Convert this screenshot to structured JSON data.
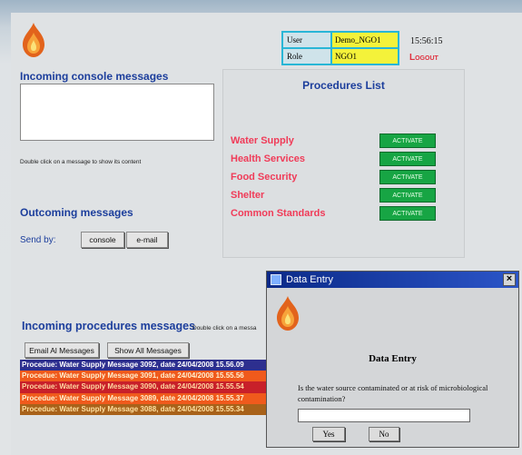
{
  "header": {
    "user_label": "User",
    "user_value": "Demo_NGO1",
    "role_label": "Role",
    "role_value": "NGO1",
    "time": "15:56:15",
    "logout": "Logout"
  },
  "incoming_console": {
    "title": "Incoming console messages",
    "hint": "Double click on a message to show its content"
  },
  "outgoing": {
    "title": "Outcoming messages",
    "send_by": "Send by:",
    "console_btn": "console",
    "email_btn": "e-mail"
  },
  "procedures": {
    "title": "Procedures List",
    "items": [
      {
        "label": "Water Supply",
        "button": "ACTIVATE"
      },
      {
        "label": "Health Services",
        "button": "ACTIVATE"
      },
      {
        "label": "Food Security",
        "button": "ACTIVATE"
      },
      {
        "label": "Shelter",
        "button": "ACTIVATE"
      },
      {
        "label": "Common Standards",
        "button": "ACTIVATE"
      }
    ]
  },
  "incoming_procedures": {
    "title": "Incoming procedures messages",
    "hint": "Double click on a messa",
    "email_all": "Email Al Messages",
    "show_all": "Show All Messages",
    "messages": [
      "Procedue: Water Supply  Message 3092, date 24/04/2008 15.56.09",
      "Procedue: Water Supply  Message 3091, date 24/04/2008 15.55.56",
      "Procedue: Water Supply  Message 3090, date 24/04/2008 15.55.54",
      "Procedue: Water Supply  Message 3089, date 24/04/2008 15.55.37",
      "Procedue: Water Supply  Message 3088, date 24/04/2008 15.55.34"
    ],
    "colors": {
      "selected": "#2d2f8f",
      "orange": "#f05a1c",
      "red": "#c8202a",
      "brown": "#a8621a"
    }
  },
  "dialog": {
    "title": "Data Entry",
    "heading": "Data Entry",
    "question": "Is the water source contaminated or at risk of microbiological contamination?",
    "input_value": "",
    "yes": "Yes",
    "no": "No",
    "close": "×"
  }
}
